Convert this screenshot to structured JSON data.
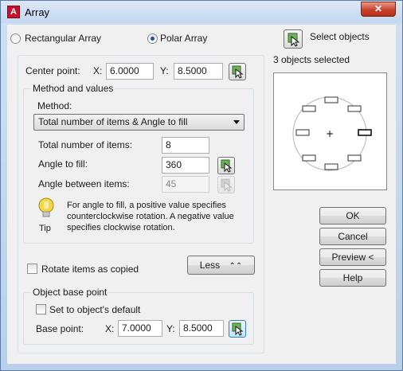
{
  "window": {
    "title": "Array",
    "app_icon_letter": "A",
    "close_glyph": "✕"
  },
  "array_type": {
    "rectangular_label": "Rectangular Array",
    "polar_label": "Polar Array",
    "selected": "polar"
  },
  "selection": {
    "select_objects_label": "Select objects",
    "status": "3 objects selected"
  },
  "center_point": {
    "label": "Center point:",
    "x_label": "X:",
    "x_value": "6.0000",
    "y_label": "Y:",
    "y_value": "8.5000"
  },
  "method_values": {
    "group_label": "Method and values",
    "method_label": "Method:",
    "method_selected": "Total number of items & Angle to fill",
    "total_items_label": "Total number of items:",
    "total_items_value": "8",
    "angle_fill_label": "Angle to fill:",
    "angle_fill_value": "360",
    "angle_between_label": "Angle between items:",
    "angle_between_value": "45"
  },
  "tip": {
    "label": "Tip",
    "text": "For angle to fill, a positive value specifies counterclockwise rotation.  A negative value specifies clockwise rotation."
  },
  "rotate_items": {
    "label": "Rotate items as copied",
    "checked": false
  },
  "less_button": {
    "label": "Less",
    "glyph": "⌃⌃"
  },
  "object_base_point": {
    "group_label": "Object base point",
    "default_label": "Set to object's default",
    "default_checked": false,
    "base_point_label": "Base point:",
    "x_label": "X:",
    "x_value": "7.0000",
    "y_label": "Y:",
    "y_value": "8.5000"
  },
  "buttons": {
    "ok": "OK",
    "cancel": "Cancel",
    "preview": "Preview <",
    "help": "Help"
  },
  "preview_pane": {
    "item_count": 8,
    "center_glyph": "+"
  },
  "colors": {
    "title_bar": "#c4d8ef",
    "close_button": "#c7432a",
    "dialog_bg": "#f0f0f0",
    "radio_dot": "#1c4f9c"
  }
}
